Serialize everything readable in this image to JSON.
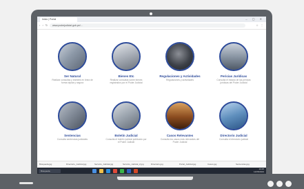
{
  "browser": {
    "tab_title": "Inicio | Portal",
    "url": "www.poderjudicial.gob.pe/...",
    "window_controls": "– ▢ ✕",
    "nav_glyphs": "‹ › ↻",
    "url_action_glyphs": "☆ ⋮"
  },
  "cards": [
    {
      "title": "Ser Natural",
      "desc": "Realizar consultas y trámites en línea de forma rápida y segura",
      "icon": "office-building-icon",
      "color": "#8d99a8"
    },
    {
      "title": "Bienes Etc",
      "desc": "Realizar consultas sobre bienes registrados por el Poder Judicial",
      "icon": "hand-document-icon",
      "color": "#a7adb6"
    },
    {
      "title": "Regulaciones y Actividades",
      "desc": "Regulaciones y actividades",
      "icon": "person-portrait-icon",
      "color": "#3d4148"
    },
    {
      "title": "Pericias Jurídicas",
      "desc": "Consulta el estado de las pericias jurídicas del Poder Judicial",
      "icon": "people-group-icon",
      "color": "#8a96a4"
    },
    {
      "title": "Sentencias",
      "desc": "Consulta sentencias judiciales",
      "icon": "handshake-icon",
      "color": "#7e8794"
    },
    {
      "title": "Boletín Judicial",
      "desc": "Consulta el boletín judicial publicado por el Poder Judicial",
      "icon": "hands-laptop-icon",
      "color": "#9aa3ad"
    },
    {
      "title": "Casos Relevantes",
      "desc": "Consulta los casos más relevantes del Poder Judicial",
      "icon": "courtroom-icon",
      "color": "#8a4b1f"
    },
    {
      "title": "Directorio Judicial",
      "desc": "Consulta el directorio judicial",
      "icon": "justice-logo-icon",
      "color": "#5f8fbd"
    }
  ],
  "downloads": [
    "Búsqueda.jpg",
    "Directorio_Judicial.jpg",
    "Servicio_Judicial.jpg",
    "Servicio_Judicial_2.jpg",
    "Directorio.jpg",
    "Portal_Judicial.jpg",
    "Casos.jpg",
    "Sentencias.jpg"
  ],
  "taskbar": {
    "search_placeholder": "Búsqueda",
    "clock_time": "10:25",
    "clock_date": "12/05/2023"
  }
}
